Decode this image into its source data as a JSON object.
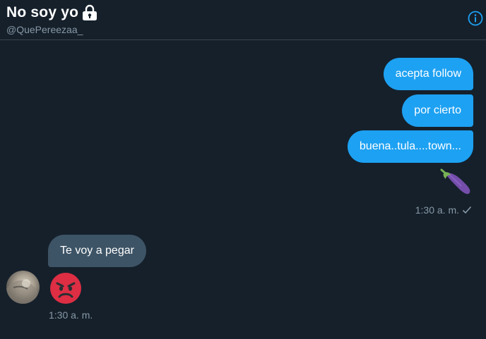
{
  "header": {
    "title": "No soy yo",
    "handle": "@QuePereezaa_",
    "icons": [
      "lock-icon",
      "info-icon"
    ]
  },
  "messages": {
    "sent": [
      "acepta follow",
      "por cierto",
      "buena..tula....town..."
    ],
    "sent_emoji": "eggplant-emoji",
    "sent_time": "1:30 a. m.",
    "received": [
      "Te voy a pegar"
    ],
    "received_emoji": "angry-face-emoji",
    "received_time": "1:30 a. m."
  },
  "colors": {
    "background": "#15202b",
    "sent_bubble": "#1da1f2",
    "received_bubble": "#3d5466",
    "muted_text": "#8899a6",
    "divider": "#38444d"
  }
}
